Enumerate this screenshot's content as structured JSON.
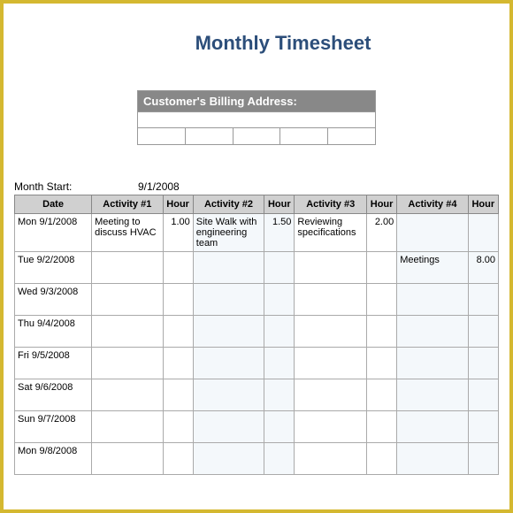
{
  "title": "Monthly Timesheet",
  "billing": {
    "header": "Customer's Billing Address:"
  },
  "monthStart": {
    "label": "Month Start:",
    "value": "9/1/2008"
  },
  "headers": {
    "date": "Date",
    "activity1": "Activity #1",
    "hour1": "Hour",
    "activity2": "Activity #2",
    "hour2": "Hour",
    "activity3": "Activity #3",
    "hour3": "Hour",
    "activity4": "Activity #4",
    "hour4": "Hour"
  },
  "rows": [
    {
      "date": "Mon 9/1/2008",
      "a1": "Meeting to discuss HVAC",
      "h1": "1.00",
      "a2": "Site Walk with engineering team",
      "h2": "1.50",
      "a3": "Reviewing specifications",
      "h3": "2.00",
      "a4": "",
      "h4": ""
    },
    {
      "date": "Tue 9/2/2008",
      "a1": "",
      "h1": "",
      "a2": "",
      "h2": "",
      "a3": "",
      "h3": "",
      "a4": "Meetings",
      "h4": "8.00"
    },
    {
      "date": "Wed 9/3/2008",
      "a1": "",
      "h1": "",
      "a2": "",
      "h2": "",
      "a3": "",
      "h3": "",
      "a4": "",
      "h4": ""
    },
    {
      "date": "Thu 9/4/2008",
      "a1": "",
      "h1": "",
      "a2": "",
      "h2": "",
      "a3": "",
      "h3": "",
      "a4": "",
      "h4": ""
    },
    {
      "date": "Fri 9/5/2008",
      "a1": "",
      "h1": "",
      "a2": "",
      "h2": "",
      "a3": "",
      "h3": "",
      "a4": "",
      "h4": ""
    },
    {
      "date": "Sat 9/6/2008",
      "a1": "",
      "h1": "",
      "a2": "",
      "h2": "",
      "a3": "",
      "h3": "",
      "a4": "",
      "h4": ""
    },
    {
      "date": "Sun 9/7/2008",
      "a1": "",
      "h1": "",
      "a2": "",
      "h2": "",
      "a3": "",
      "h3": "",
      "a4": "",
      "h4": ""
    },
    {
      "date": "Mon 9/8/2008",
      "a1": "",
      "h1": "",
      "a2": "",
      "h2": "",
      "a3": "",
      "h3": "",
      "a4": "",
      "h4": ""
    }
  ]
}
